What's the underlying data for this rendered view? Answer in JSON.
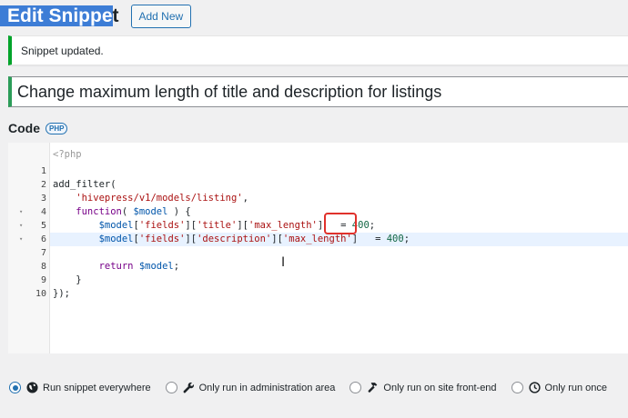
{
  "header": {
    "title_selected_part": "Edit Snippe",
    "title_rest": "t",
    "add_new_label": "Add New"
  },
  "notice": {
    "text": "Snippet updated."
  },
  "snippet_title": "Change maximum length of title and description for listings",
  "code_section": {
    "label": "Code",
    "badge": "PHP"
  },
  "editor": {
    "opening_tag": "<?php",
    "line_numbers": [
      "1",
      "2",
      "3",
      "4",
      "5",
      "6",
      "7",
      "8",
      "9",
      "10"
    ],
    "fold_markers": [
      "",
      "",
      "",
      "▾",
      "▾",
      "▾",
      "",
      "",
      "",
      ""
    ],
    "highlighted_line": 6,
    "lines": [
      [],
      [
        {
          "t": "add_filter(",
          "c": "t-plain"
        }
      ],
      [
        {
          "t": "    'hivepress/v1/models/listing'",
          "c": "t-str"
        },
        {
          "t": ",",
          "c": "t-punc"
        }
      ],
      [
        {
          "t": "    function",
          "c": "t-kw"
        },
        {
          "t": "( ",
          "c": "t-punc"
        },
        {
          "t": "$model",
          "c": "t-var"
        },
        {
          "t": " ) {",
          "c": "t-punc"
        }
      ],
      [
        {
          "t": "        $model",
          "c": "t-var"
        },
        {
          "t": "[",
          "c": "t-punc"
        },
        {
          "t": "'fields'",
          "c": "t-str"
        },
        {
          "t": "][",
          "c": "t-punc"
        },
        {
          "t": "'title'",
          "c": "t-str"
        },
        {
          "t": "][",
          "c": "t-punc"
        },
        {
          "t": "'max_length'",
          "c": "t-str"
        },
        {
          "t": "]   = ",
          "c": "t-punc"
        },
        {
          "t": "400",
          "c": "t-num"
        },
        {
          "t": ";",
          "c": "t-punc"
        }
      ],
      [
        {
          "t": "        $model",
          "c": "t-var"
        },
        {
          "t": "[",
          "c": "t-punc"
        },
        {
          "t": "'fields'",
          "c": "t-str"
        },
        {
          "t": "][",
          "c": "t-punc"
        },
        {
          "t": "'description'",
          "c": "t-str"
        },
        {
          "t": "][",
          "c": "t-punc"
        },
        {
          "t": "'max_length'",
          "c": "t-str"
        },
        {
          "t": "]   = ",
          "c": "t-punc"
        },
        {
          "t": "400",
          "c": "t-num"
        },
        {
          "t": ";",
          "c": "t-punc"
        }
      ],
      [],
      [
        {
          "t": "        return ",
          "c": "t-kw"
        },
        {
          "t": "$model",
          "c": "t-var"
        },
        {
          "t": ";",
          "c": "t-punc"
        }
      ],
      [
        {
          "t": "    }",
          "c": "t-punc"
        }
      ],
      [
        {
          "t": "});",
          "c": "t-punc"
        }
      ]
    ]
  },
  "scope_options": [
    {
      "label": "Run snippet everywhere",
      "icon": "globe-icon",
      "checked": true
    },
    {
      "label": "Only run in administration area",
      "icon": "wrench-icon",
      "checked": false
    },
    {
      "label": "Only run on site front-end",
      "icon": "hammer-icon",
      "checked": false
    },
    {
      "label": "Only run once",
      "icon": "clock-icon",
      "checked": false
    }
  ],
  "colors": {
    "accent": "#2271b1",
    "notice_border": "#00a32a",
    "annotation": "#e0312b",
    "selection": "#3d7dd6"
  }
}
